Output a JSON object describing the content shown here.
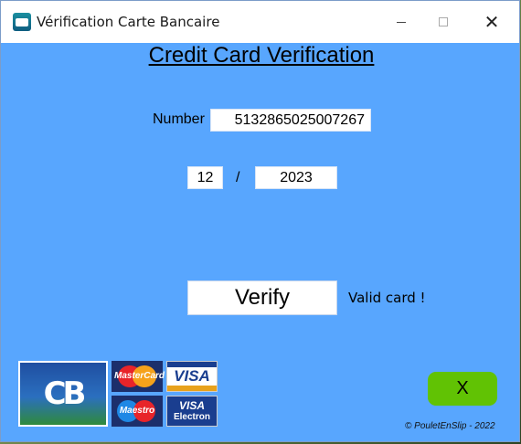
{
  "window": {
    "title": "Vérification Carte Bancaire",
    "icon": "credit-card-app-icon",
    "controls": {
      "minimize": "minimize-icon",
      "maximize": "maximize-icon",
      "close": "✕"
    }
  },
  "form": {
    "heading": "Credit Card Verification",
    "number_label": "Number",
    "card_number_value": "5132865025007267",
    "expiry_month_value": "12",
    "expiry_separator": "/",
    "expiry_year_value": "2023",
    "verify_button_label": "Verify",
    "status_text": "Valid card !"
  },
  "logos": {
    "cb": "CB",
    "mastercard": "MasterCard",
    "visa": "VISA",
    "maestro": "Maestro",
    "visa_electron_top": "VISA",
    "visa_electron_bottom": "Electron"
  },
  "footer": {
    "exit_button_label": "X",
    "copyright": "© PouletEnSlip - 2022"
  },
  "colors": {
    "window_background": "#58a6fe",
    "exit_button": "#61c204"
  }
}
